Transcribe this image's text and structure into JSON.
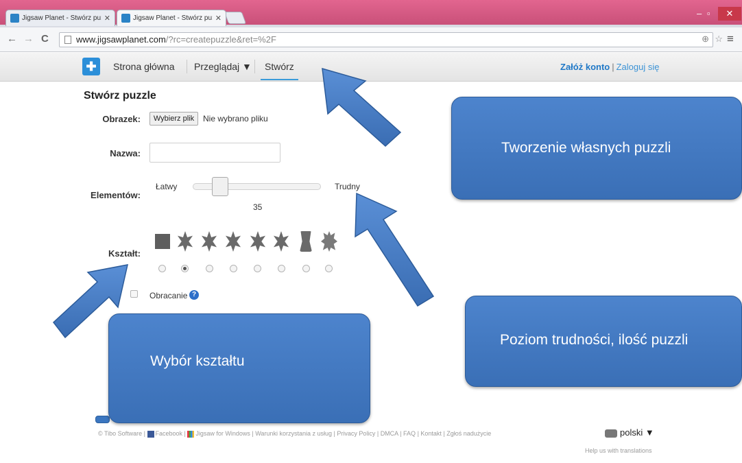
{
  "browser": {
    "tabs": [
      {
        "title": "Jigsaw Planet - Stwórz pu:"
      },
      {
        "title": "Jigsaw Planet - Stwórz pu:"
      }
    ],
    "url_host": "www.jigsawplanet.com",
    "url_path": "/?rc=createpuzzle&ret=%2F"
  },
  "header": {
    "nav": [
      "Strona główna",
      "Przeglądaj ▼",
      "Stwórz"
    ],
    "register": "Załóż konto",
    "separator": "|",
    "login": "Zaloguj się"
  },
  "form": {
    "title": "Stwórz puzzle",
    "image_label": "Obrazek:",
    "choose_file": "Wybierz plik",
    "file_status": "Nie wybrano pliku",
    "name_label": "Nazwa:",
    "name_value": "",
    "pieces_label": "Elementów:",
    "easy": "Łatwy",
    "hard": "Trudny",
    "pieces_count": "35",
    "shape_label": "Kształt:",
    "selected_shape_index": 1,
    "rotation_label": "Obracanie",
    "help": "?"
  },
  "footer": {
    "copyright": "© Tibo Software",
    "facebook": "Facebook",
    "windows": "Jigsaw for Windows",
    "links": [
      "Warunki korzystania z usług",
      "Privacy Policy",
      "DMCA",
      "FAQ",
      "Kontakt",
      "Zgłoś nadużycie"
    ],
    "language": "polski ▼",
    "translate_help": "Help us with translations"
  },
  "callouts": {
    "create": "Tworzenie własnych puzzli",
    "shape": "Wybór kształtu",
    "difficulty": "Poziom trudności, ilość puzzli"
  },
  "colors": {
    "callout": "#4a80c8",
    "link": "#1f78c7",
    "tab_accent": "#d65a85"
  }
}
